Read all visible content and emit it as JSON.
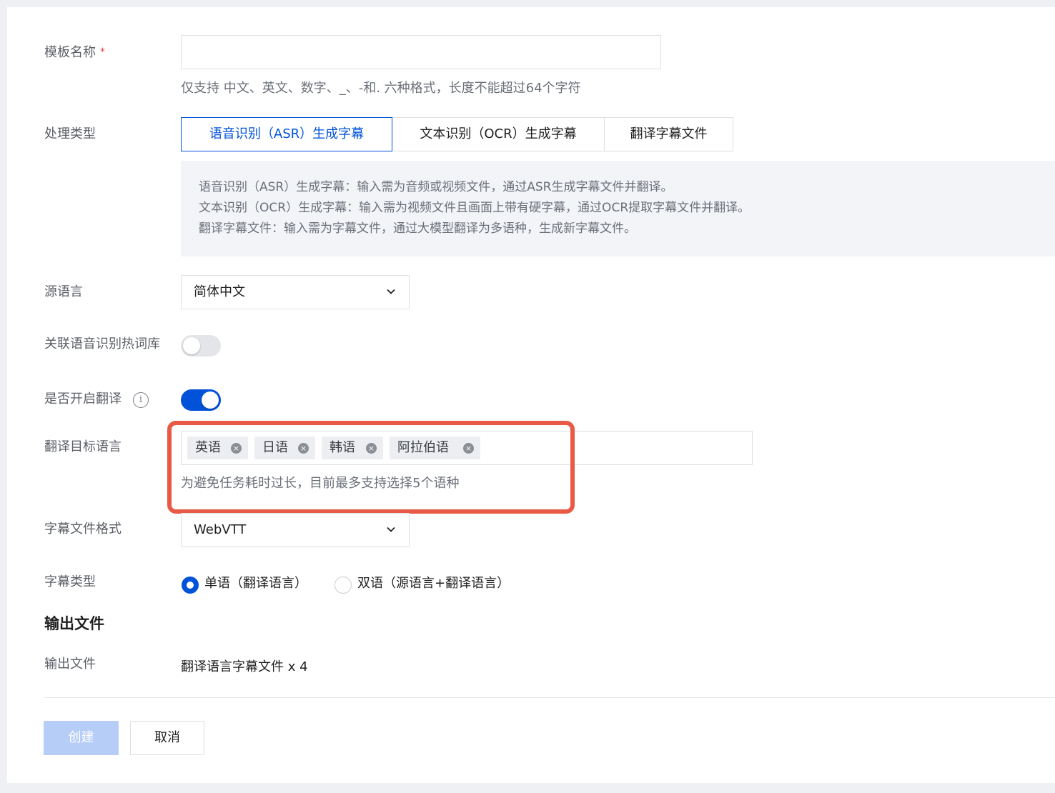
{
  "form": {
    "template_name": {
      "label": "模板名称",
      "required_mark": "*",
      "value": "",
      "hint": "仅支持 中文、英文、数字、_、-和. 六种格式，长度不能超过64个字符"
    },
    "process_type": {
      "label": "处理类型",
      "options": [
        "语音识别（ASR）生成字幕",
        "文本识别（OCR）生成字幕",
        "翻译字幕文件"
      ],
      "selected_index": 0,
      "descriptions": [
        "语音识别（ASR）生成字幕：输入需为音频或视频文件，通过ASR生成字幕文件并翻译。",
        "文本识别（OCR）生成字幕：输入需为视频文件且画面上带有硬字幕，通过OCR提取字幕文件并翻译。",
        "翻译字幕文件：输入需为字幕文件，通过大模型翻译为多语种，生成新字幕文件。"
      ]
    },
    "source_language": {
      "label": "源语言",
      "value": "简体中文"
    },
    "hotword_library": {
      "label": "关联语音识别热词库",
      "enabled": false
    },
    "enable_translation": {
      "label": "是否开启翻译",
      "info_icon": "i",
      "enabled": true
    },
    "target_languages": {
      "label": "翻译目标语言",
      "tags": [
        "英语",
        "日语",
        "韩语",
        "阿拉伯语"
      ],
      "remove_icon": "×",
      "hint": "为避免任务耗时过长，目前最多支持选择5个语种"
    },
    "subtitle_format": {
      "label": "字幕文件格式",
      "value": "WebVTT"
    },
    "subtitle_type": {
      "label": "字幕类型",
      "options": [
        "单语（翻译语言）",
        "双语（源语言+翻译语言）"
      ],
      "selected_index": 0
    }
  },
  "output": {
    "section_title": "输出文件",
    "label": "输出文件",
    "value": "翻译语言字幕文件 x 4"
  },
  "actions": {
    "create_label": "创建",
    "cancel_label": "取消"
  },
  "colors": {
    "primary": "#0052d9",
    "primary_disabled": "#b5cdf7",
    "highlight_border": "#e85a45",
    "required": "#e54545"
  }
}
